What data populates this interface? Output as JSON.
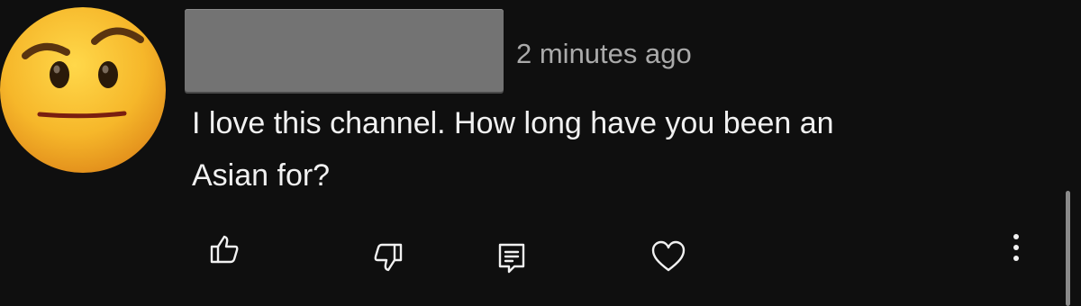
{
  "comment": {
    "author_redacted": true,
    "timestamp": "2 minutes ago",
    "text_lines": [
      "I love this channel. How long have you been an",
      "Asian for?"
    ]
  },
  "avatar": {
    "icon": "skeptical-raised-eyebrow-emoji-icon",
    "colors": {
      "face": "#f6b72a",
      "face_shadow": "#e08a1a",
      "features": "#2a1a0a",
      "mouth": "#7a1e10"
    }
  },
  "actions": {
    "like_icon": "thumbs-up-icon",
    "dislike_icon": "thumbs-down-icon",
    "reply_icon": "reply-comment-icon",
    "heart_icon": "heart-icon",
    "more_icon": "more-vertical-icon"
  },
  "theme": {
    "background": "#0f0f0f",
    "text": "#f1f1f1",
    "secondary_text": "#aaaaaa",
    "redaction": "#737373"
  }
}
